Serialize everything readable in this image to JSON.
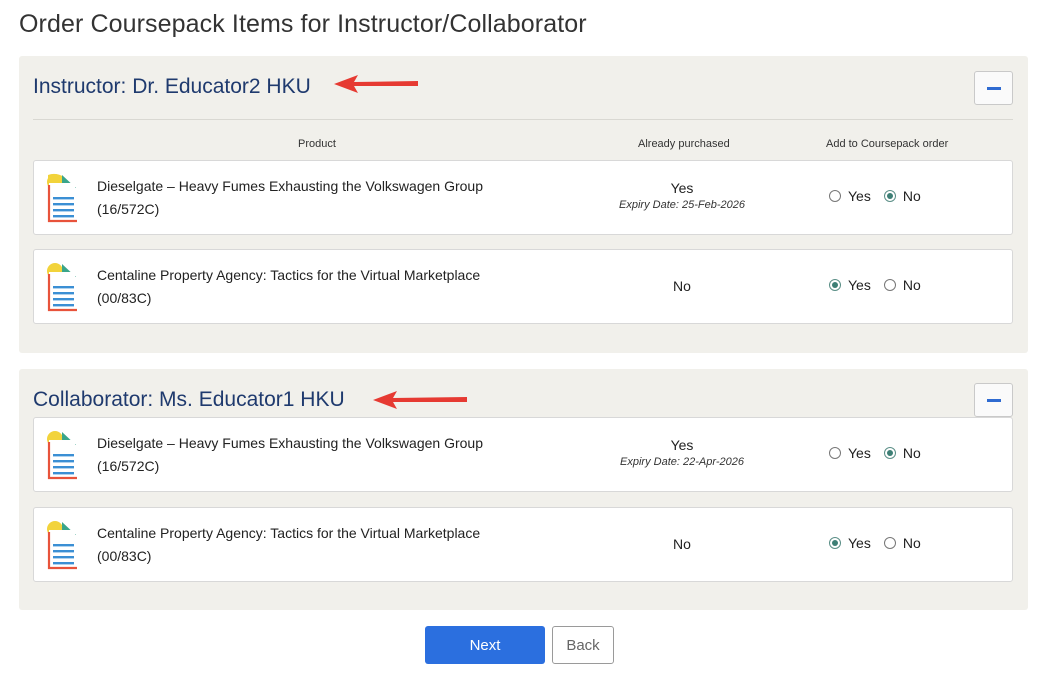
{
  "page": {
    "title": "Order Coursepack Items for Instructor/Collaborator"
  },
  "columns": {
    "product": "Product",
    "purchased": "Already purchased",
    "add": "Add to Coursepack order"
  },
  "radio_labels": {
    "yes": "Yes",
    "no": "No"
  },
  "icons": {
    "document": "document-icon",
    "collapse": "minus-icon",
    "annotation": "arrow-icon"
  },
  "colors": {
    "accent": "#2b6fdf",
    "heading": "#1f3a6e",
    "arrow": "#e63a32",
    "panel_bg": "#f1f0eb"
  },
  "sections": [
    {
      "header": "Instructor: Dr. Educator2 HKU",
      "items": [
        {
          "title": "Dieselgate – Heavy Fumes Exhausting the Volkswagen Group",
          "code": "(16/572C)",
          "purchased": "Yes",
          "expiry": "Expiry Date: 25-Feb-2026",
          "selected": "No"
        },
        {
          "title": "Centaline Property Agency: Tactics for the Virtual Marketplace",
          "code": "(00/83C)",
          "purchased": "No",
          "expiry": "",
          "selected": "Yes"
        }
      ]
    },
    {
      "header": "Collaborator: Ms. Educator1 HKU",
      "items": [
        {
          "title": "Dieselgate – Heavy Fumes Exhausting the Volkswagen Group",
          "code": "(16/572C)",
          "purchased": "Yes",
          "expiry": "Expiry Date: 22-Apr-2026",
          "selected": "No"
        },
        {
          "title": "Centaline Property Agency: Tactics for the Virtual Marketplace",
          "code": "(00/83C)",
          "purchased": "No",
          "expiry": "",
          "selected": "Yes"
        }
      ]
    }
  ],
  "buttons": {
    "next": "Next",
    "back": "Back"
  }
}
